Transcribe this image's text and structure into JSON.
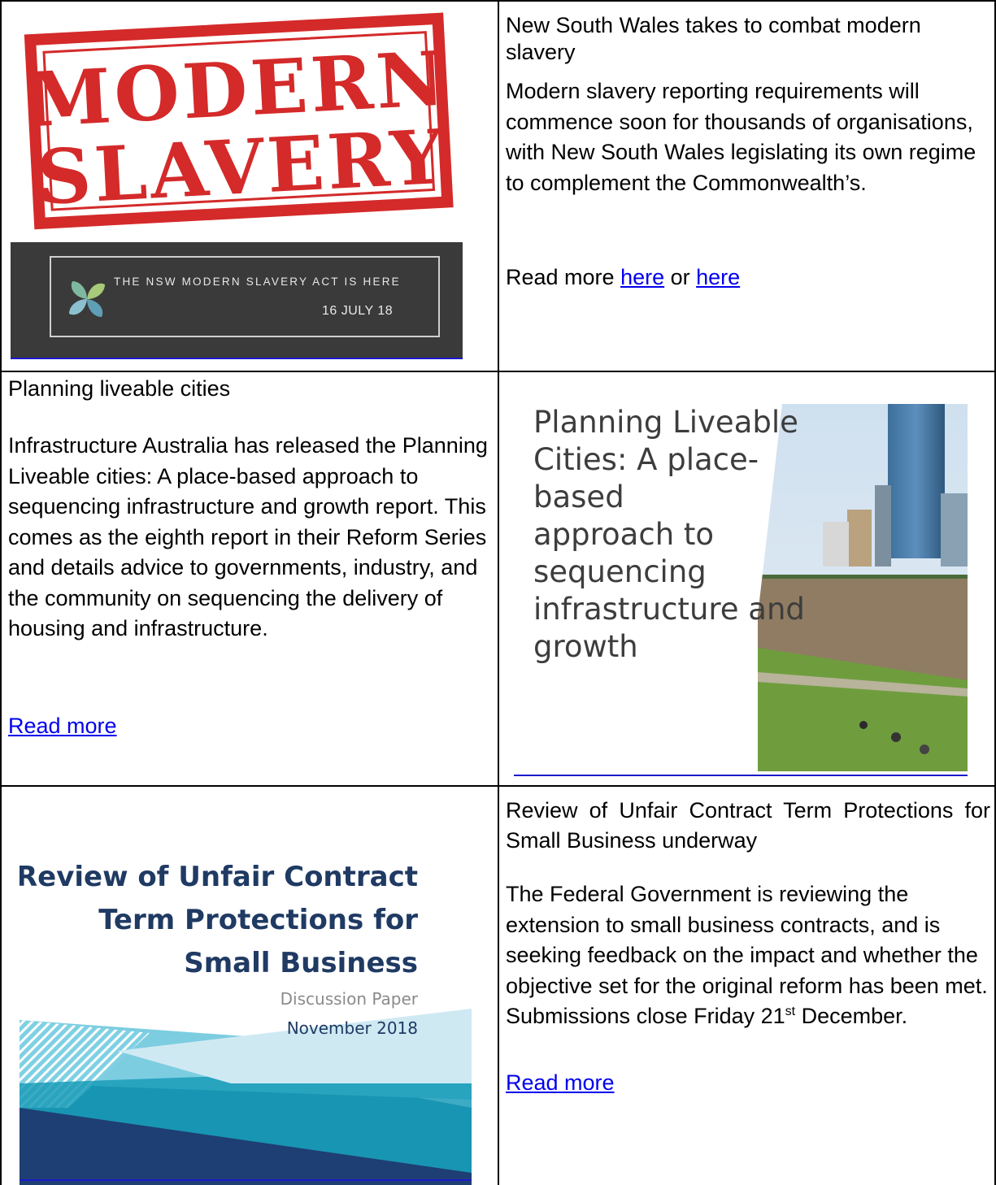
{
  "row1": {
    "image": {
      "stamp_line1": "MODERN",
      "stamp_line2": "SLAVERY",
      "banner_text": "THE NSW MODERN SLAVERY ACT IS HERE",
      "banner_date": "16 JULY 18",
      "stamp_color": "#d42a2a"
    },
    "title": "New South Wales takes to combat modern slavery",
    "body": "Modern slavery reporting requirements will commence soon for thousands of organisations, with New South Wales legislating its own regime to complement the Commonwealth’s.",
    "read_prefix": "Read more ",
    "link1": "here",
    "read_or": " or ",
    "link2": "here"
  },
  "row2": {
    "title": "Planning liveable cities",
    "body": "Infrastructure Australia has released the Planning Liveable cities: A place-based approach to sequencing infrastructure and growth report. This comes as the eighth report in their Reform Series and details advice to governments, industry, and the community on sequencing the delivery of housing and infrastructure.",
    "link": "Read more",
    "image": {
      "title": "Planning Liveable\nCities: A place-based\napproach to\nsequencing\ninfrastructure and\ngrowth"
    }
  },
  "row3": {
    "image": {
      "title": "Review of Unfair Contract\nTerm Protections for\nSmall Business",
      "subtitle": "Discussion Paper",
      "date": "November 2018"
    },
    "title": "Review of Unfair Contract Term Protections for Small Business underway",
    "body_before": "The Federal Government is reviewing the extension to small business contracts, and is seeking feedback on the impact and whether the objective set for the original reform has been met. Submissions close Friday 21",
    "body_sup": "st",
    "body_after": " December.",
    "link": "Read more"
  }
}
